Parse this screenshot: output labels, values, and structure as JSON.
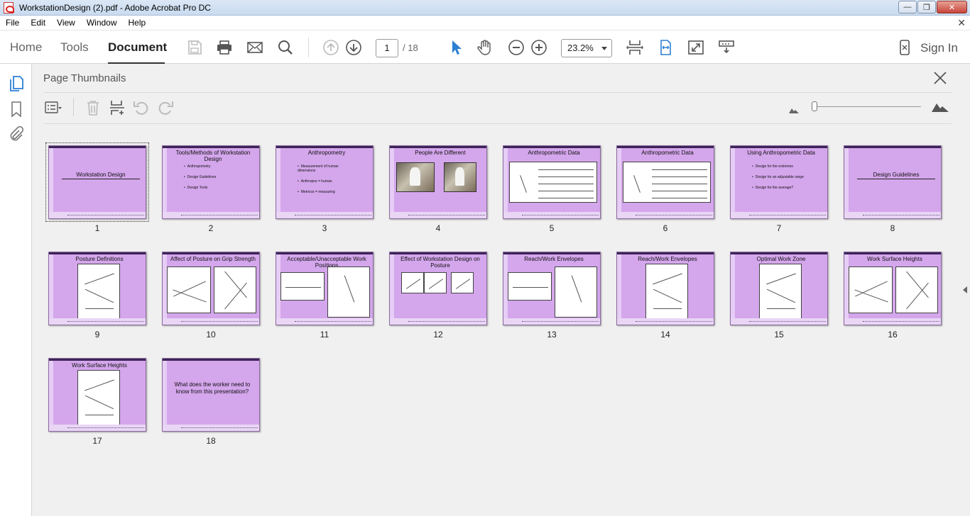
{
  "window": {
    "title": "WorkstationDesign (2).pdf - Adobe Acrobat Pro DC",
    "minimize": "—",
    "restore": "❐",
    "close": "✕"
  },
  "menu": {
    "items": [
      "File",
      "Edit",
      "View",
      "Window",
      "Help"
    ],
    "close_glyph": "✕"
  },
  "toolbar": {
    "tabs": [
      "Home",
      "Tools",
      "Document"
    ],
    "active_tab": "Document",
    "page_current": "1",
    "page_total": "/ 18",
    "zoom": "23.2%",
    "sign_in": "Sign In"
  },
  "panel": {
    "title": "Page Thumbnails"
  },
  "thumbnails": [
    {
      "num": "1",
      "title": "Workstation Design",
      "layout": "centered-title",
      "selected": true
    },
    {
      "num": "2",
      "title": "Tools/Methods of Workstation Design",
      "layout": "bullets",
      "bullets": [
        "Anthropometry",
        "Design Guidelines",
        "Design Tools"
      ]
    },
    {
      "num": "3",
      "title": "Anthropometry",
      "layout": "bullets",
      "bullets": [
        "Measurement of human dimensions",
        "Anthropos = human",
        "Metricos = measuring"
      ]
    },
    {
      "num": "4",
      "title": "People Are Different",
      "layout": "photos"
    },
    {
      "num": "5",
      "title": "Anthropometric Data",
      "layout": "chart-table"
    },
    {
      "num": "6",
      "title": "Anthropometric Data",
      "layout": "chart-table"
    },
    {
      "num": "7",
      "title": "Using Anthropometric Data",
      "layout": "bullets",
      "bullets": [
        "Design for the extremes",
        "Design for an adjustable range",
        "Design for the average?"
      ]
    },
    {
      "num": "8",
      "title": "Design Guidelines",
      "layout": "centered-title"
    },
    {
      "num": "9",
      "title": "Posture Definitions",
      "layout": "figure-center"
    },
    {
      "num": "10",
      "title": "Affect of Posture on Grip Strength",
      "layout": "figure-two"
    },
    {
      "num": "11",
      "title": "Acceptable/Unacceptable Work Positions",
      "layout": "figure-two-tall"
    },
    {
      "num": "12",
      "title": "Effect of Workstation Design on Posture",
      "layout": "figure-three"
    },
    {
      "num": "13",
      "title": "Reach/Work Envelopes",
      "layout": "figure-two-tall"
    },
    {
      "num": "14",
      "title": "Reach/Work Envelopes",
      "layout": "figure-center"
    },
    {
      "num": "15",
      "title": "Optimal Work Zone",
      "layout": "figure-center"
    },
    {
      "num": "16",
      "title": "Work Surface Heights",
      "layout": "figure-two"
    },
    {
      "num": "17",
      "title": "Work Surface Heights",
      "layout": "figure-center"
    },
    {
      "num": "18",
      "title": "",
      "layout": "question",
      "body": "What does the worker need to know from this presentation?"
    }
  ],
  "colors": {
    "slide_bg": "#d4a6ec",
    "slide_topbar": "#3d2458",
    "accent_blue": "#2d7fd2"
  }
}
